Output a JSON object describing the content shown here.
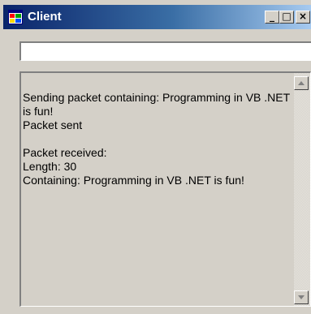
{
  "window": {
    "title": "Client",
    "buttons": {
      "minimize_glyph": "_",
      "maximize_glyph": "□",
      "close_glyph": "×"
    },
    "icon": "app-window-icon"
  },
  "input": {
    "value": "",
    "placeholder": ""
  },
  "display": {
    "lines": [
      "Sending packet containing: Programming in VB .NET is fun!",
      "Packet sent",
      "",
      "Packet received:",
      "Length: 30",
      "Containing: Programming in VB .NET is fun!"
    ]
  },
  "colors": {
    "titlebar_start": "#0a246a",
    "titlebar_end": "#a6caf0",
    "window_bg": "#d4d0c8"
  }
}
